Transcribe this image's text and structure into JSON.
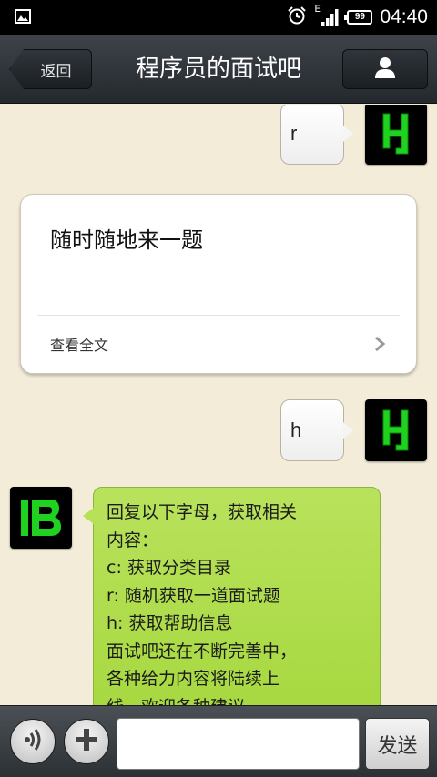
{
  "status_bar": {
    "time": "04:40",
    "battery": "99",
    "network": "E",
    "icons": [
      "image-notification-icon",
      "alarm-clock-icon",
      "signal-icon",
      "battery-icon"
    ]
  },
  "header": {
    "back_label": "返回",
    "title": "程序员的面试吧",
    "profile_icon": "person-icon"
  },
  "messages": [
    {
      "from": "me",
      "text": "r"
    },
    {
      "from": "service",
      "type": "card",
      "title": "随时随地来一题",
      "footer": "查看全文"
    },
    {
      "from": "me",
      "text": "h"
    },
    {
      "from": "service",
      "lines": [
        "回复以下字母，获取相关",
        "内容：",
        "c: 获取分类目录",
        "r: 随机获取一道面试题",
        "h: 获取帮助信息",
        "面试吧还在不断完善中，",
        "各种给力内容将陆续上",
        "线，欢迎各种建议"
      ]
    }
  ],
  "input_bar": {
    "voice_icon": "voice-icon",
    "plus_icon": "plus-icon",
    "send_label": "发送",
    "input_value": ""
  },
  "colors": {
    "accent_green": "#22dd22",
    "bubble_green": "#b2de52",
    "chat_background": "#f3ecd9"
  }
}
